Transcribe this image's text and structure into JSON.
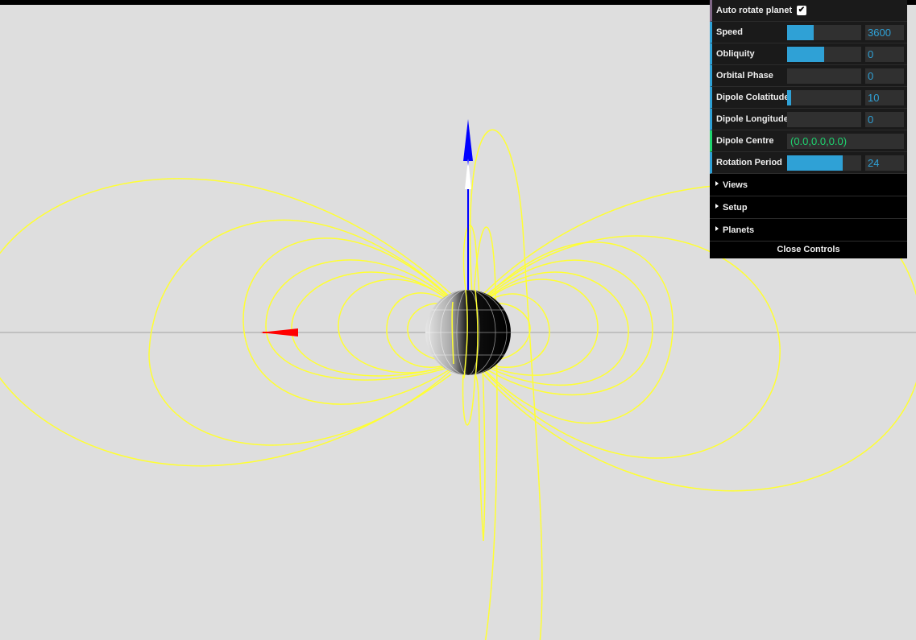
{
  "controls": {
    "auto_rotate": {
      "label": "Auto rotate planet",
      "checked": true,
      "check_glyph": "✔"
    },
    "speed": {
      "label": "Speed",
      "value": "3600",
      "fraction": 0.36
    },
    "obliquity": {
      "label": "Obliquity",
      "value": "0",
      "fraction": 0.5
    },
    "orbital_phase": {
      "label": "Orbital Phase",
      "value": "0",
      "fraction": 0.0
    },
    "dipole_colatitude": {
      "label": "Dipole Colatitude",
      "value": "10",
      "fraction": 0.055
    },
    "dipole_longitude": {
      "label": "Dipole Longitude",
      "value": "0",
      "fraction": 0.0
    },
    "dipole_centre": {
      "label": "Dipole Centre",
      "value": "(0.0,0.0,0.0)"
    },
    "rotation_period": {
      "label": "Rotation Period",
      "value": "24",
      "fraction": 0.75
    },
    "folders": {
      "views": "Views",
      "setup": "Setup",
      "planets": "Planets"
    },
    "close_label": "Close Controls"
  },
  "colors": {
    "background": "#dedede",
    "field_lines": "#ffff33",
    "slider_fill": "#2fa1d6",
    "string_value": "#1ed36f",
    "x_arrow": "red",
    "z_arrow": "blue"
  },
  "icons": [
    "checkbox-check-icon",
    "folder-triangle-icon"
  ]
}
